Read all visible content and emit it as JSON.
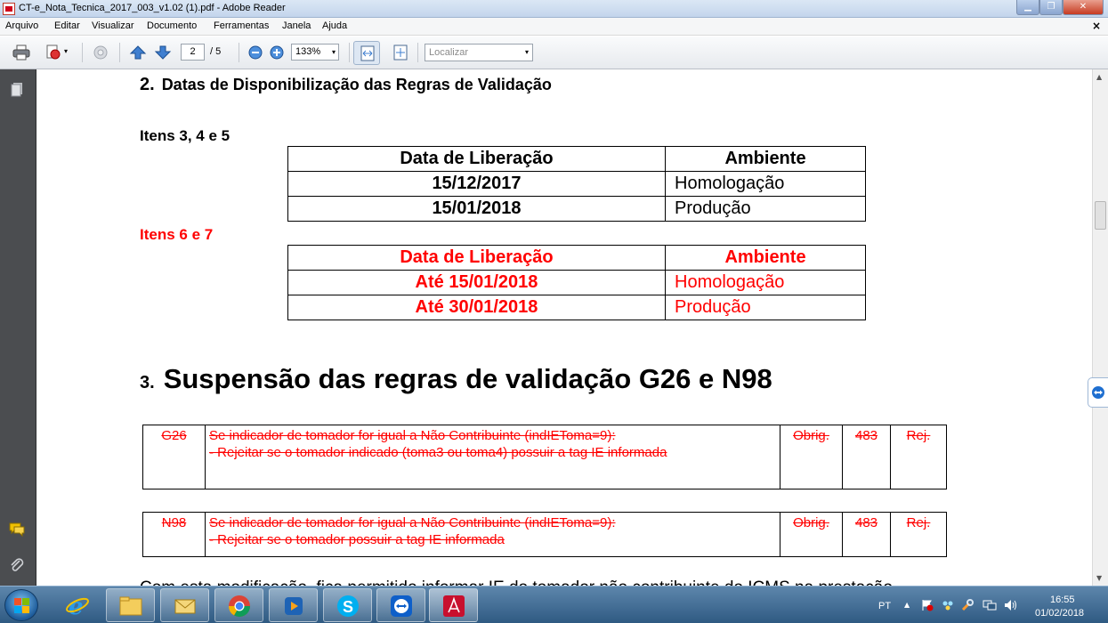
{
  "window": {
    "title": "CT-e_Nota_Tecnica_2017_003_v1.02 (1).pdf - Adobe Reader",
    "min_label": "▁",
    "max_label": "❐",
    "close_label": "✕"
  },
  "menu": {
    "items": [
      "Arquivo",
      "Editar",
      "Visualizar",
      "Documento",
      "Ferramentas",
      "Janela",
      "Ajuda"
    ],
    "doc_close": "×"
  },
  "toolbar": {
    "page_current": "2",
    "page_total": "/ 5",
    "zoom": "133%",
    "find_placeholder": "Localizar",
    "dropdown_glyph": "▾"
  },
  "document": {
    "section2": {
      "number": "2.",
      "title": "Datas de Disponibilização das Regras de Validação"
    },
    "group1": {
      "label": "Itens 3, 4 e 5",
      "color": "#000000",
      "header": [
        "Data de Liberação",
        "Ambiente"
      ],
      "rows": [
        [
          "15/12/2017",
          "Homologação"
        ],
        [
          "15/01/2018",
          "Produção"
        ]
      ]
    },
    "group2": {
      "label": "Itens 6 e 7",
      "color": "#ff0000",
      "header": [
        "Data de Liberação",
        "Ambiente"
      ],
      "rows": [
        [
          "Até 15/01/2018",
          "Homologação"
        ],
        [
          "Até 30/01/2018",
          "Produção"
        ]
      ]
    },
    "section3": {
      "number": "3.",
      "title": "Suspensão das regras de validação G26 e N98"
    },
    "rules": [
      {
        "code": "G26",
        "lines": [
          "Se indicador de tomador for igual a Não Contribuinte (indIEToma=9):",
          "- Rejeitar se o tomador indicado (toma3 ou toma4) possuir a tag IE informada"
        ],
        "obrig": "Obrig.",
        "number": "483",
        "rej": "Rej."
      },
      {
        "code": "N98",
        "lines": [
          "Se indicador de tomador for igual a Não Contribuinte (indIEToma=9):",
          "- Rejeitar se o tomador possuir a tag IE informada"
        ],
        "obrig": "Obrig.",
        "number": "483",
        "rej": "Rej."
      }
    ],
    "cut_text": "Com esta modificação, fica permitido informar IE do tomador não contribuinte do ICMS na prestação"
  },
  "scrollbar": {
    "up": "▲",
    "down": "▼"
  },
  "taskbar": {
    "language": "PT",
    "tray_arrow": "▲",
    "time": "16:55",
    "date": "01/02/2018"
  },
  "colors": {
    "accent": "#1f5fa8",
    "red_text": "#ff0000",
    "left_panel": "#4b4d50"
  }
}
